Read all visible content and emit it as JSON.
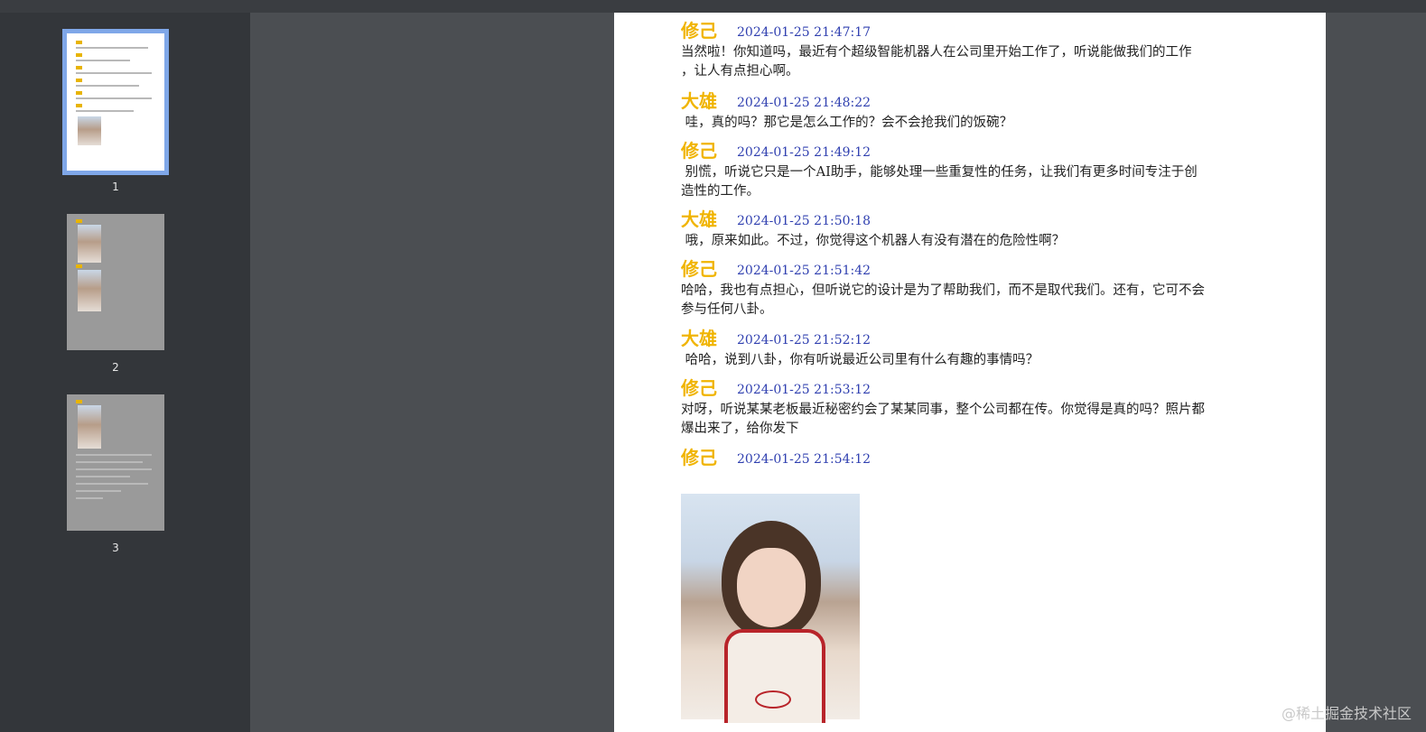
{
  "thumbnails": [
    {
      "number": "1",
      "selected": true
    },
    {
      "number": "2",
      "selected": false
    },
    {
      "number": "3",
      "selected": false
    }
  ],
  "messages": [
    {
      "sender": "修己",
      "time": "2024-01-25 21:47:17",
      "text": "当然啦！你知道吗，最近有个超级智能机器人在公司里开始工作了，听说能做我们的工作\n，让人有点担心啊。"
    },
    {
      "sender": "大雄",
      "time": "2024-01-25 21:48:22",
      "text": " 哇，真的吗？那它是怎么工作的？会不会抢我们的饭碗？"
    },
    {
      "sender": "修己",
      "time": "2024-01-25 21:49:12",
      "text": " 别慌，听说它只是一个AI助手，能够处理一些重复性的任务，让我们有更多时间专注于创\n造性的工作。"
    },
    {
      "sender": "大雄",
      "time": "2024-01-25 21:50:18",
      "text": " 哦，原来如此。不过，你觉得这个机器人有没有潜在的危险性啊？"
    },
    {
      "sender": "修己",
      "time": "2024-01-25 21:51:42",
      "text": "哈哈，我也有点担心，但听说它的设计是为了帮助我们，而不是取代我们。还有，它可不会\n参与任何八卦。"
    },
    {
      "sender": "大雄",
      "time": "2024-01-25 21:52:12",
      "text": " 哈哈，说到八卦，你有听说最近公司里有什么有趣的事情吗？"
    },
    {
      "sender": "修己",
      "time": "2024-01-25 21:53:12",
      "text": "对呀，听说某某老板最近秘密约会了某某同事，整个公司都在传。你觉得是真的吗？照片都\n爆出来了，给你发下"
    },
    {
      "sender": "修己",
      "time": "2024-01-25 21:54:12",
      "text": ""
    }
  ],
  "watermark": "@稀土掘金技术社区",
  "colors": {
    "sender": "#f0b400",
    "timestamp": "#3040b0",
    "selection": "#7fa7e8"
  }
}
